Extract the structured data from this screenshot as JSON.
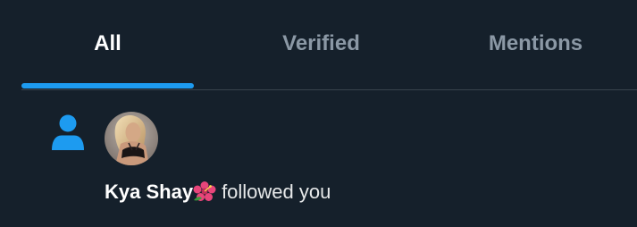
{
  "colors": {
    "background": "#15202b",
    "accent": "#1d9bf0",
    "divider": "#38444d",
    "inactive_tab": "#8b98a5",
    "text": "#e7e9ea"
  },
  "tabs": [
    {
      "label": "All",
      "active": true
    },
    {
      "label": "Verified",
      "active": false
    },
    {
      "label": "Mentions",
      "active": false
    }
  ],
  "notification": {
    "type_icon": "person-icon",
    "avatar_icon": "user-avatar",
    "user_name": "Kya Shay",
    "name_emoji": "hibiscus-icon",
    "action_text": "followed you"
  }
}
